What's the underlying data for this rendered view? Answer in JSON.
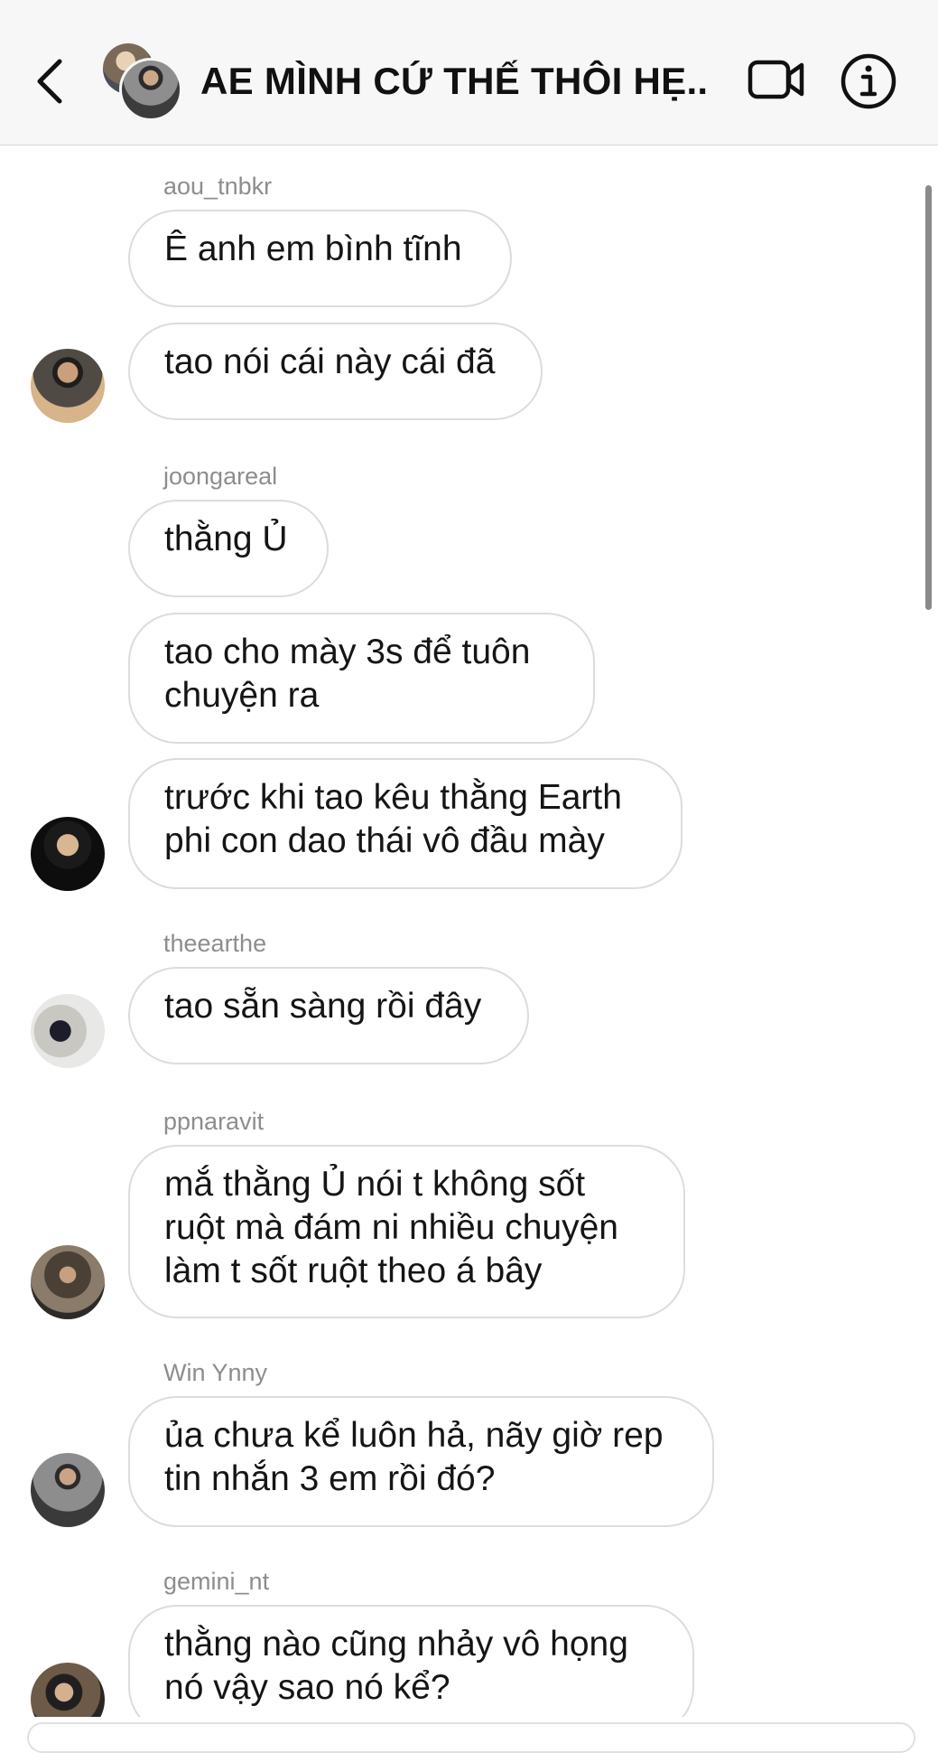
{
  "header": {
    "title": "AE MÌNH CỨ THẾ THÔI HẸ...",
    "back_icon": "chevron-left-icon",
    "video_icon": "video-camera-icon",
    "info_icon": "info-icon"
  },
  "messages": [
    {
      "sender": "aou_tnbkr",
      "bubbles": [
        "Ê anh em bình tĩnh",
        "tao nói cái này cái đã"
      ]
    },
    {
      "sender": "joongareal",
      "bubbles": [
        "thằng Ủ",
        "tao cho mày 3s để tuôn chuyện ra",
        "trước khi tao kêu thằng Earth phi con dao thái vô đầu mày"
      ]
    },
    {
      "sender": "theearthe",
      "bubbles": [
        "tao sẵn sàng rồi đây"
      ]
    },
    {
      "sender": "ppnaravit",
      "bubbles": [
        "mắ thằng Ủ nói t không sốt ruột mà đám ni nhiều chuyện làm t sốt ruột theo á bây"
      ]
    },
    {
      "sender": "Win Ynny",
      "bubbles": [
        "ủa chưa kể luôn hả, nãy giờ rep tin nhắn 3 em rồi đó?"
      ]
    },
    {
      "sender": "gemini_nt",
      "bubbles": [
        "thằng nào cũng nhảy vô họng nó vậy sao nó kể?"
      ]
    }
  ]
}
